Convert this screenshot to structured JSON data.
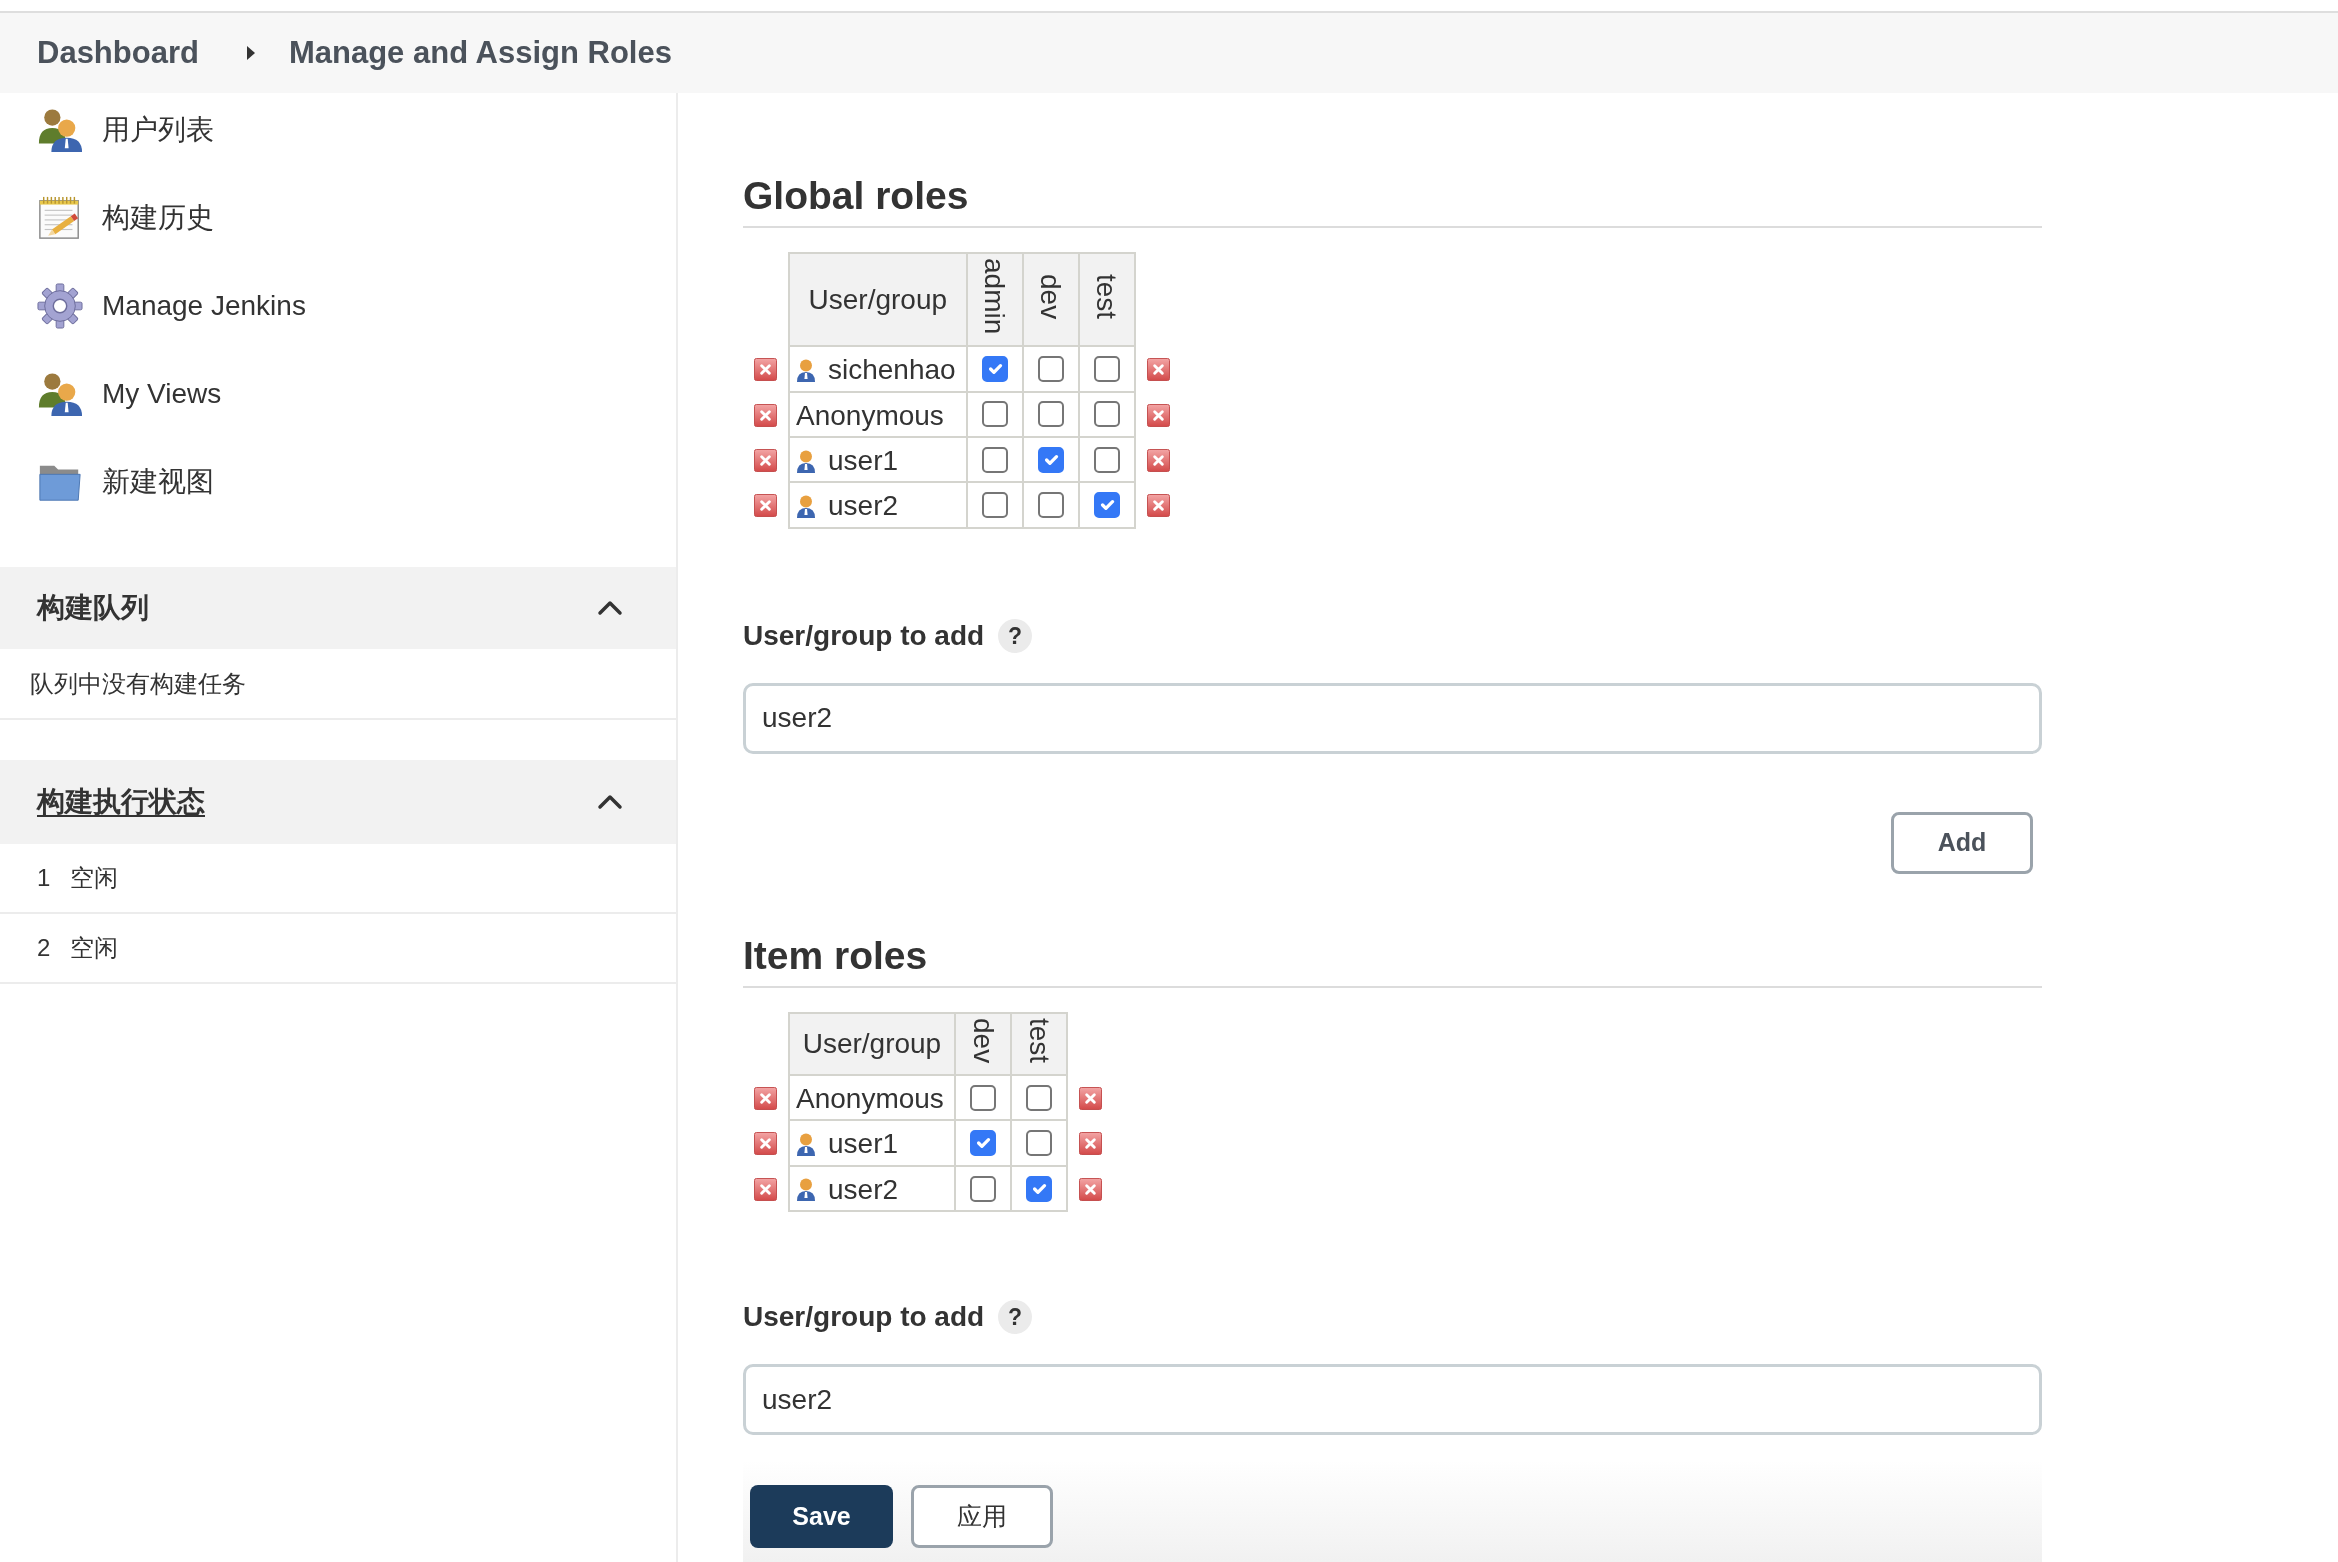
{
  "header": {
    "breadcrumb": [
      {
        "label": "Dashboard"
      },
      {
        "label": "Manage and Assign Roles"
      }
    ]
  },
  "sidebar": {
    "tasks": [
      {
        "label": "用户列表"
      },
      {
        "label": "构建历史"
      },
      {
        "label": "Manage Jenkins"
      },
      {
        "label": "My Views"
      },
      {
        "label": "新建视图"
      }
    ],
    "build_queue": {
      "title": "构建队列",
      "expanded": true,
      "message": "队列中没有构建任务"
    },
    "executors": {
      "title": "构建执行状态",
      "expanded": true,
      "rows": [
        {
          "number": "1",
          "status": "空闲"
        },
        {
          "number": "2",
          "status": "空闲"
        }
      ]
    }
  },
  "global_roles": {
    "title": "Global roles",
    "columns": [
      "User/group",
      "admin",
      "dev",
      "test"
    ],
    "rows": [
      {
        "name": "sichenhao",
        "kind": "user",
        "roles": [
          {
            "checked": true
          },
          {
            "checked": false
          },
          {
            "checked": false
          }
        ]
      },
      {
        "name": "Anonymous",
        "kind": "anonymous",
        "roles": [
          {
            "checked": false
          },
          {
            "checked": false
          },
          {
            "checked": false
          }
        ]
      },
      {
        "name": "user1",
        "kind": "user",
        "roles": [
          {
            "checked": false
          },
          {
            "checked": true
          },
          {
            "checked": false
          }
        ]
      },
      {
        "name": "user2",
        "kind": "user",
        "roles": [
          {
            "checked": false
          },
          {
            "checked": false
          },
          {
            "checked": true
          }
        ]
      }
    ],
    "add": {
      "label": "User/group to add",
      "help": "?",
      "value": "user2",
      "button": "Add"
    }
  },
  "item_roles": {
    "title": "Item roles",
    "columns": [
      "User/group",
      "dev",
      "test"
    ],
    "rows": [
      {
        "name": "Anonymous",
        "kind": "anonymous",
        "roles": [
          {
            "checked": false
          },
          {
            "checked": false
          }
        ]
      },
      {
        "name": "user1",
        "kind": "user",
        "roles": [
          {
            "checked": true
          },
          {
            "checked": false
          }
        ]
      },
      {
        "name": "user2",
        "kind": "user",
        "roles": [
          {
            "checked": false
          },
          {
            "checked": true
          }
        ]
      }
    ],
    "add": {
      "label": "User/group to add",
      "help": "?",
      "value": "user2"
    }
  },
  "actions": [
    {
      "label": "Save",
      "kind": "primary"
    },
    {
      "label": "应用",
      "kind": "secondary"
    }
  ]
}
